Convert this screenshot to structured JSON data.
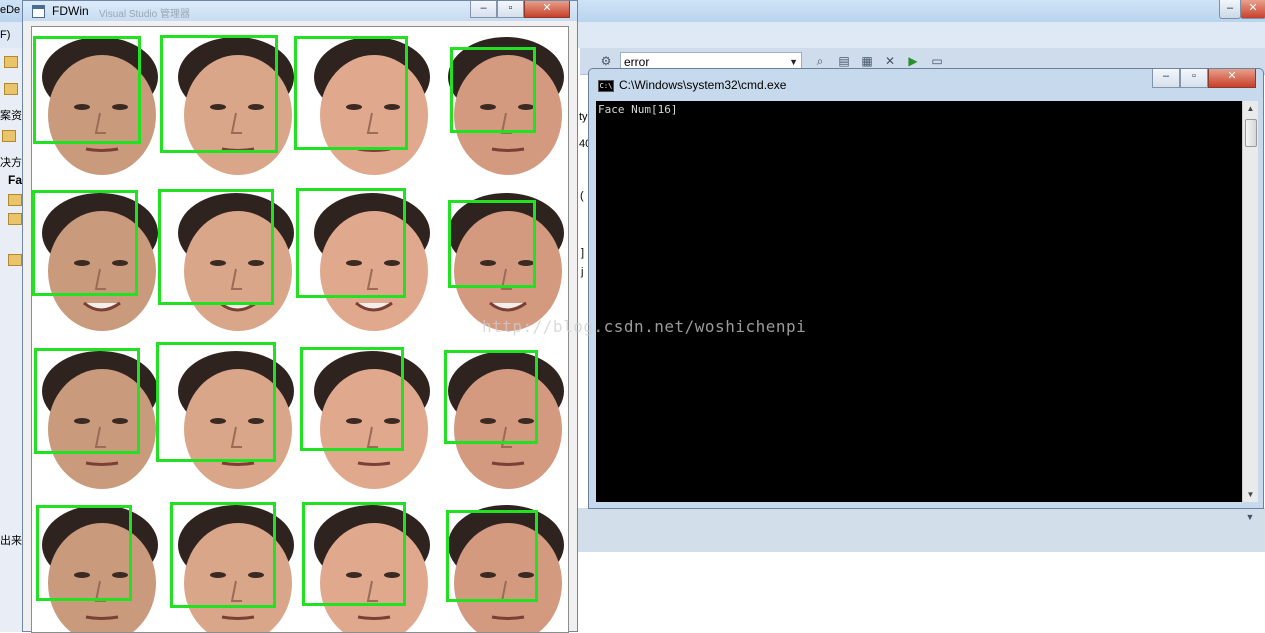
{
  "vs": {
    "title_fragment": "eDe",
    "menu_fragment": "F)",
    "config_combo_value": "error",
    "left_fragments": [
      "案资",
      "决方",
      "Fa"
    ],
    "right_fragments": [
      "ty",
      "40",
      "(",
      "]",
      "j"
    ],
    "bottom_fragment": "出来"
  },
  "fdwin": {
    "title": "FDWin",
    "ghost_title": "Visual Studio 管理器",
    "detections": [
      {
        "face_id": "face-r1c1",
        "tone": "#c99a7c"
      },
      {
        "face_id": "face-r1c2",
        "tone": "#d9a689"
      },
      {
        "face_id": "face-r1c3",
        "tone": "#e0a98e"
      },
      {
        "face_id": "face-r1c4",
        "tone": "#d39a80"
      },
      {
        "face_id": "face-r2c1",
        "tone": "#c99a7c"
      },
      {
        "face_id": "face-r2c2",
        "tone": "#d9a689"
      },
      {
        "face_id": "face-r2c3",
        "tone": "#e0a98e"
      },
      {
        "face_id": "face-r2c4",
        "tone": "#d39a80"
      },
      {
        "face_id": "face-r3c1",
        "tone": "#c99a7c"
      },
      {
        "face_id": "face-r3c2",
        "tone": "#d9a689"
      },
      {
        "face_id": "face-r3c3",
        "tone": "#e0a98e"
      },
      {
        "face_id": "face-r3c4",
        "tone": "#d39a80"
      },
      {
        "face_id": "face-r4c1",
        "tone": "#c99a7c"
      },
      {
        "face_id": "face-r4c2",
        "tone": "#d9a689"
      },
      {
        "face_id": "face-r4c3",
        "tone": "#e0a98e"
      },
      {
        "face_id": "face-r4c4",
        "tone": "#d39a80"
      }
    ],
    "box_color": "#22e022"
  },
  "cmd": {
    "title": "C:\\Windows\\system32\\cmd.exe",
    "icon_text": "C:\\",
    "output": "Face Num[16]"
  },
  "watermark": "http://blog.csdn.net/woshichenpi"
}
